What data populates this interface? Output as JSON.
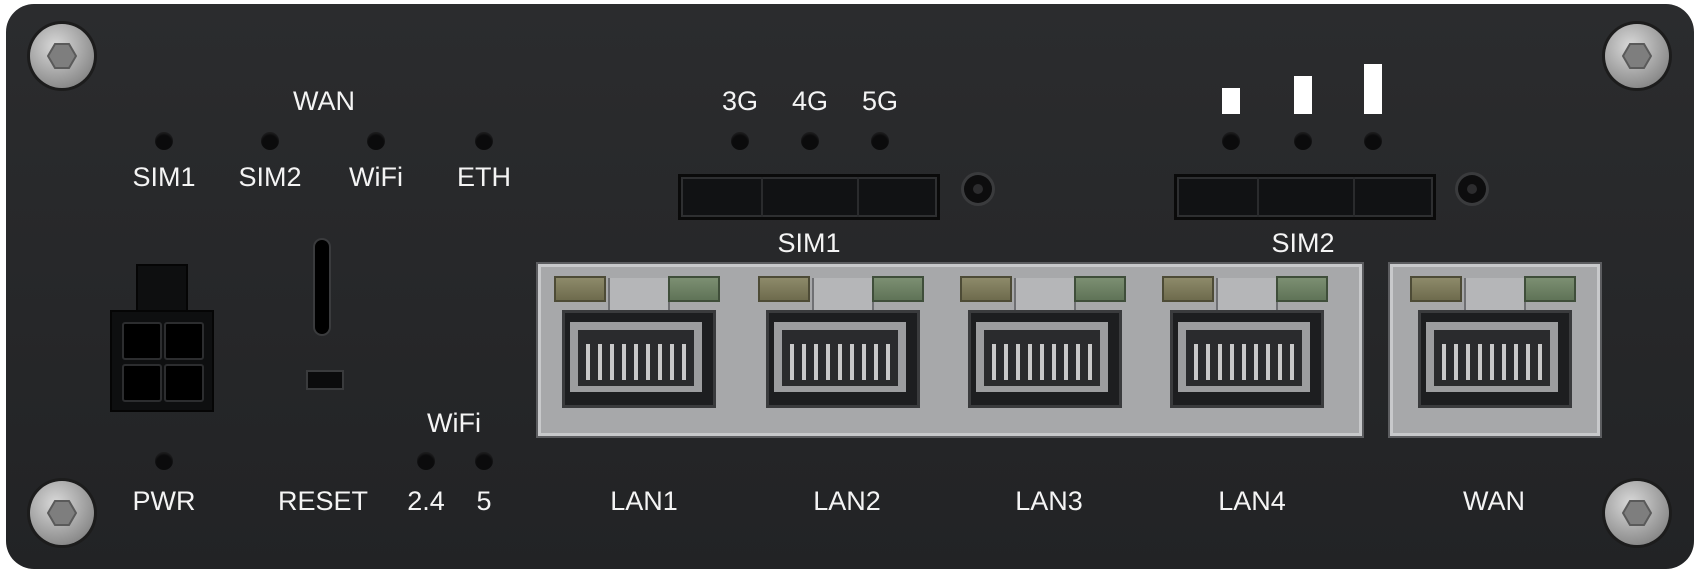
{
  "device": {
    "wan_group_label": "WAN",
    "wan_leds": [
      "SIM1",
      "SIM2",
      "WiFi",
      "ETH"
    ],
    "network_types": [
      "3G",
      "4G",
      "5G"
    ],
    "signal_strength_bars": [
      1,
      2,
      3
    ],
    "sim_slots": [
      "SIM1",
      "SIM2"
    ],
    "power_label": "PWR",
    "reset_label": "RESET",
    "wifi_group_label": "WiFi",
    "wifi_bands": [
      "2.4",
      "5"
    ],
    "lan_ports": [
      "LAN1",
      "LAN2",
      "LAN3",
      "LAN4"
    ],
    "wan_port": "WAN",
    "colors": {
      "panel": "#262729",
      "text": "#f4f4f4",
      "port_block": "#a7a8aa",
      "link_led": "#7c7a5a",
      "activity_led": "#6b8062"
    }
  }
}
